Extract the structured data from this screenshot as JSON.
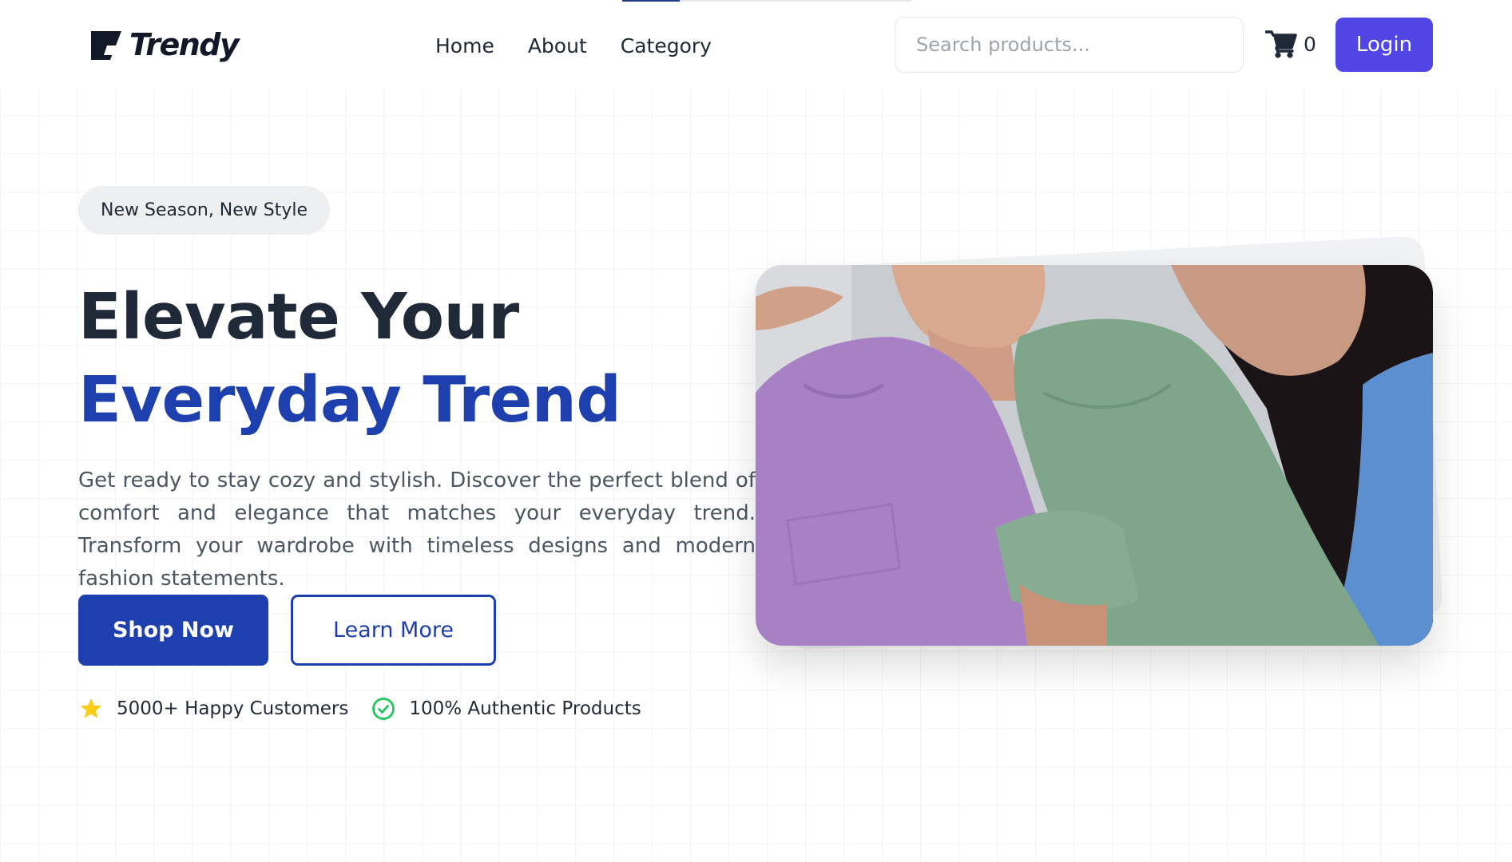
{
  "brand": {
    "name": "Trendy"
  },
  "nav": {
    "items": [
      {
        "label": "Home"
      },
      {
        "label": "About"
      },
      {
        "label": "Category"
      }
    ]
  },
  "search": {
    "placeholder": "Search products..."
  },
  "cart": {
    "count": "0"
  },
  "auth": {
    "login_label": "Login"
  },
  "hero": {
    "badge": "New Season, New Style",
    "headline_line1": "Elevate Your",
    "headline_line2": "Everyday Trend",
    "description": "Get ready to stay cozy and stylish. Discover the perfect blend of comfort and elegance that matches your everyday trend. Transform your wardrobe with timeless designs and modern fashion statements.",
    "primary_cta": "Shop Now",
    "secondary_cta": "Learn More",
    "features": [
      {
        "icon": "star-icon",
        "label": "5000+ Happy Customers"
      },
      {
        "icon": "check-circle-icon",
        "label": "100% Authentic Products"
      }
    ]
  },
  "colors": {
    "primary": "#1e40af",
    "login": "#4f46e5",
    "heading": "#1f2937",
    "star": "#facc15",
    "check": "#22c55e"
  }
}
